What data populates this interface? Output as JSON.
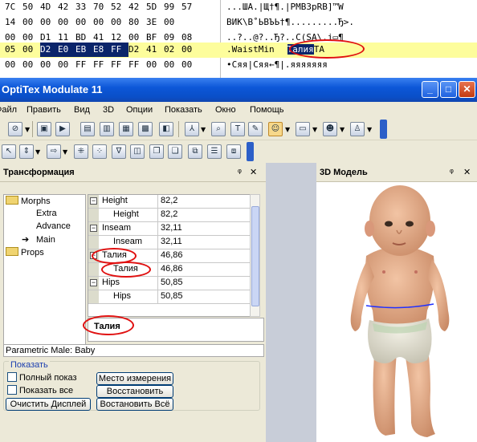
{
  "hex_editor": {
    "rows": [
      {
        "bytes": [
          "7C",
          "50",
          "4D",
          "42",
          "33",
          "70",
          "52",
          "42",
          "5D",
          "99",
          "57"
        ],
        "chars": "...ША.|Щ†¶.|PMB3pRB]™W",
        "highlight": false
      },
      {
        "bytes": [
          "14",
          "00",
          "00",
          "00",
          "00",
          "00",
          "00",
          "80",
          "3E",
          "00"
        ],
        "chars": "ВИК\\В˚ЬВЪЬ†¶.........Ђ>.",
        "highlight": false
      },
      {
        "bytes": [
          "00",
          "00",
          "D1",
          "11",
          "BD",
          "41",
          "12",
          "00",
          "BF",
          "09",
          "08"
        ],
        "chars": "..?..@?..Ђ?..С(SA\\.i▭¶",
        "highlight": false
      },
      {
        "bytes": [
          "05",
          "00",
          "D2",
          "E0",
          "EB",
          "E8",
          "FF",
          "D2",
          "41",
          "02",
          "00"
        ],
        "chars_pre": ".WaistMin",
        "chars_sel": "Талия",
        "chars_post": "TA",
        "highlight": true,
        "selected_bytes": [
          2,
          3,
          4,
          5,
          6
        ]
      },
      {
        "bytes": [
          "00",
          "00",
          "00",
          "00",
          "FF",
          "FF",
          "FF",
          "FF",
          "00",
          "00",
          "00"
        ],
        "chars": "•Сяя|Сяя←¶|.яяяяяяя",
        "highlight": false
      }
    ]
  },
  "window": {
    "title": "OptiTex Modulate 11",
    "buttons": {
      "minimize": "_",
      "maximize": "□",
      "close": "✕"
    }
  },
  "menu": [
    "Файл",
    "Править",
    "Вид",
    "3D",
    "Опции",
    "Показать",
    "Окно",
    "Помощь"
  ],
  "left_panel": {
    "title": "Трансформация",
    "pin": "ᵠ",
    "close": "✕",
    "tree": [
      {
        "label": "Morphs",
        "level": 0,
        "folder": true
      },
      {
        "label": "Extra",
        "level": 1
      },
      {
        "label": "Advance",
        "level": 1
      },
      {
        "label": "Main",
        "level": 1,
        "arrow": true
      },
      {
        "label": "Props",
        "level": 0,
        "folder": true
      }
    ],
    "grid": [
      {
        "name": "Height",
        "value": "82,2",
        "group": true
      },
      {
        "name": "Height",
        "value": "82,2",
        "group": false
      },
      {
        "name": "Inseam",
        "value": "32,11",
        "group": true
      },
      {
        "name": "Inseam",
        "value": "32,11",
        "group": false
      },
      {
        "name": "Талия",
        "value": "46,86",
        "group": true
      },
      {
        "name": "Талия",
        "value": "46,86",
        "group": false
      },
      {
        "name": "Hips",
        "value": "50,85",
        "group": true
      },
      {
        "name": "Hips",
        "value": "50,85",
        "group": false
      }
    ],
    "description": "Талия",
    "status": "Parametric Male: Baby",
    "show_group": {
      "label": "Показать",
      "checkbox_full": "Полный показ",
      "checkbox_all": "Показать все",
      "btn_clear": "Очистить Дисплей",
      "btn_measure": "Место измерения",
      "btn_restore": "Восстановить",
      "btn_restore_all": "Востановить Всё"
    }
  },
  "right_panel": {
    "title": "3D Модель",
    "pin": "ᵠ",
    "close": "✕"
  },
  "colors": {
    "titlebar": "#0c57d8",
    "annotation": "#e01010",
    "highlight_row": "#fdfd9c",
    "selection": "#0a246a",
    "skin": "#e6ad8c",
    "diaper": "#e6e4d6",
    "waist_line": "#2030ff"
  }
}
